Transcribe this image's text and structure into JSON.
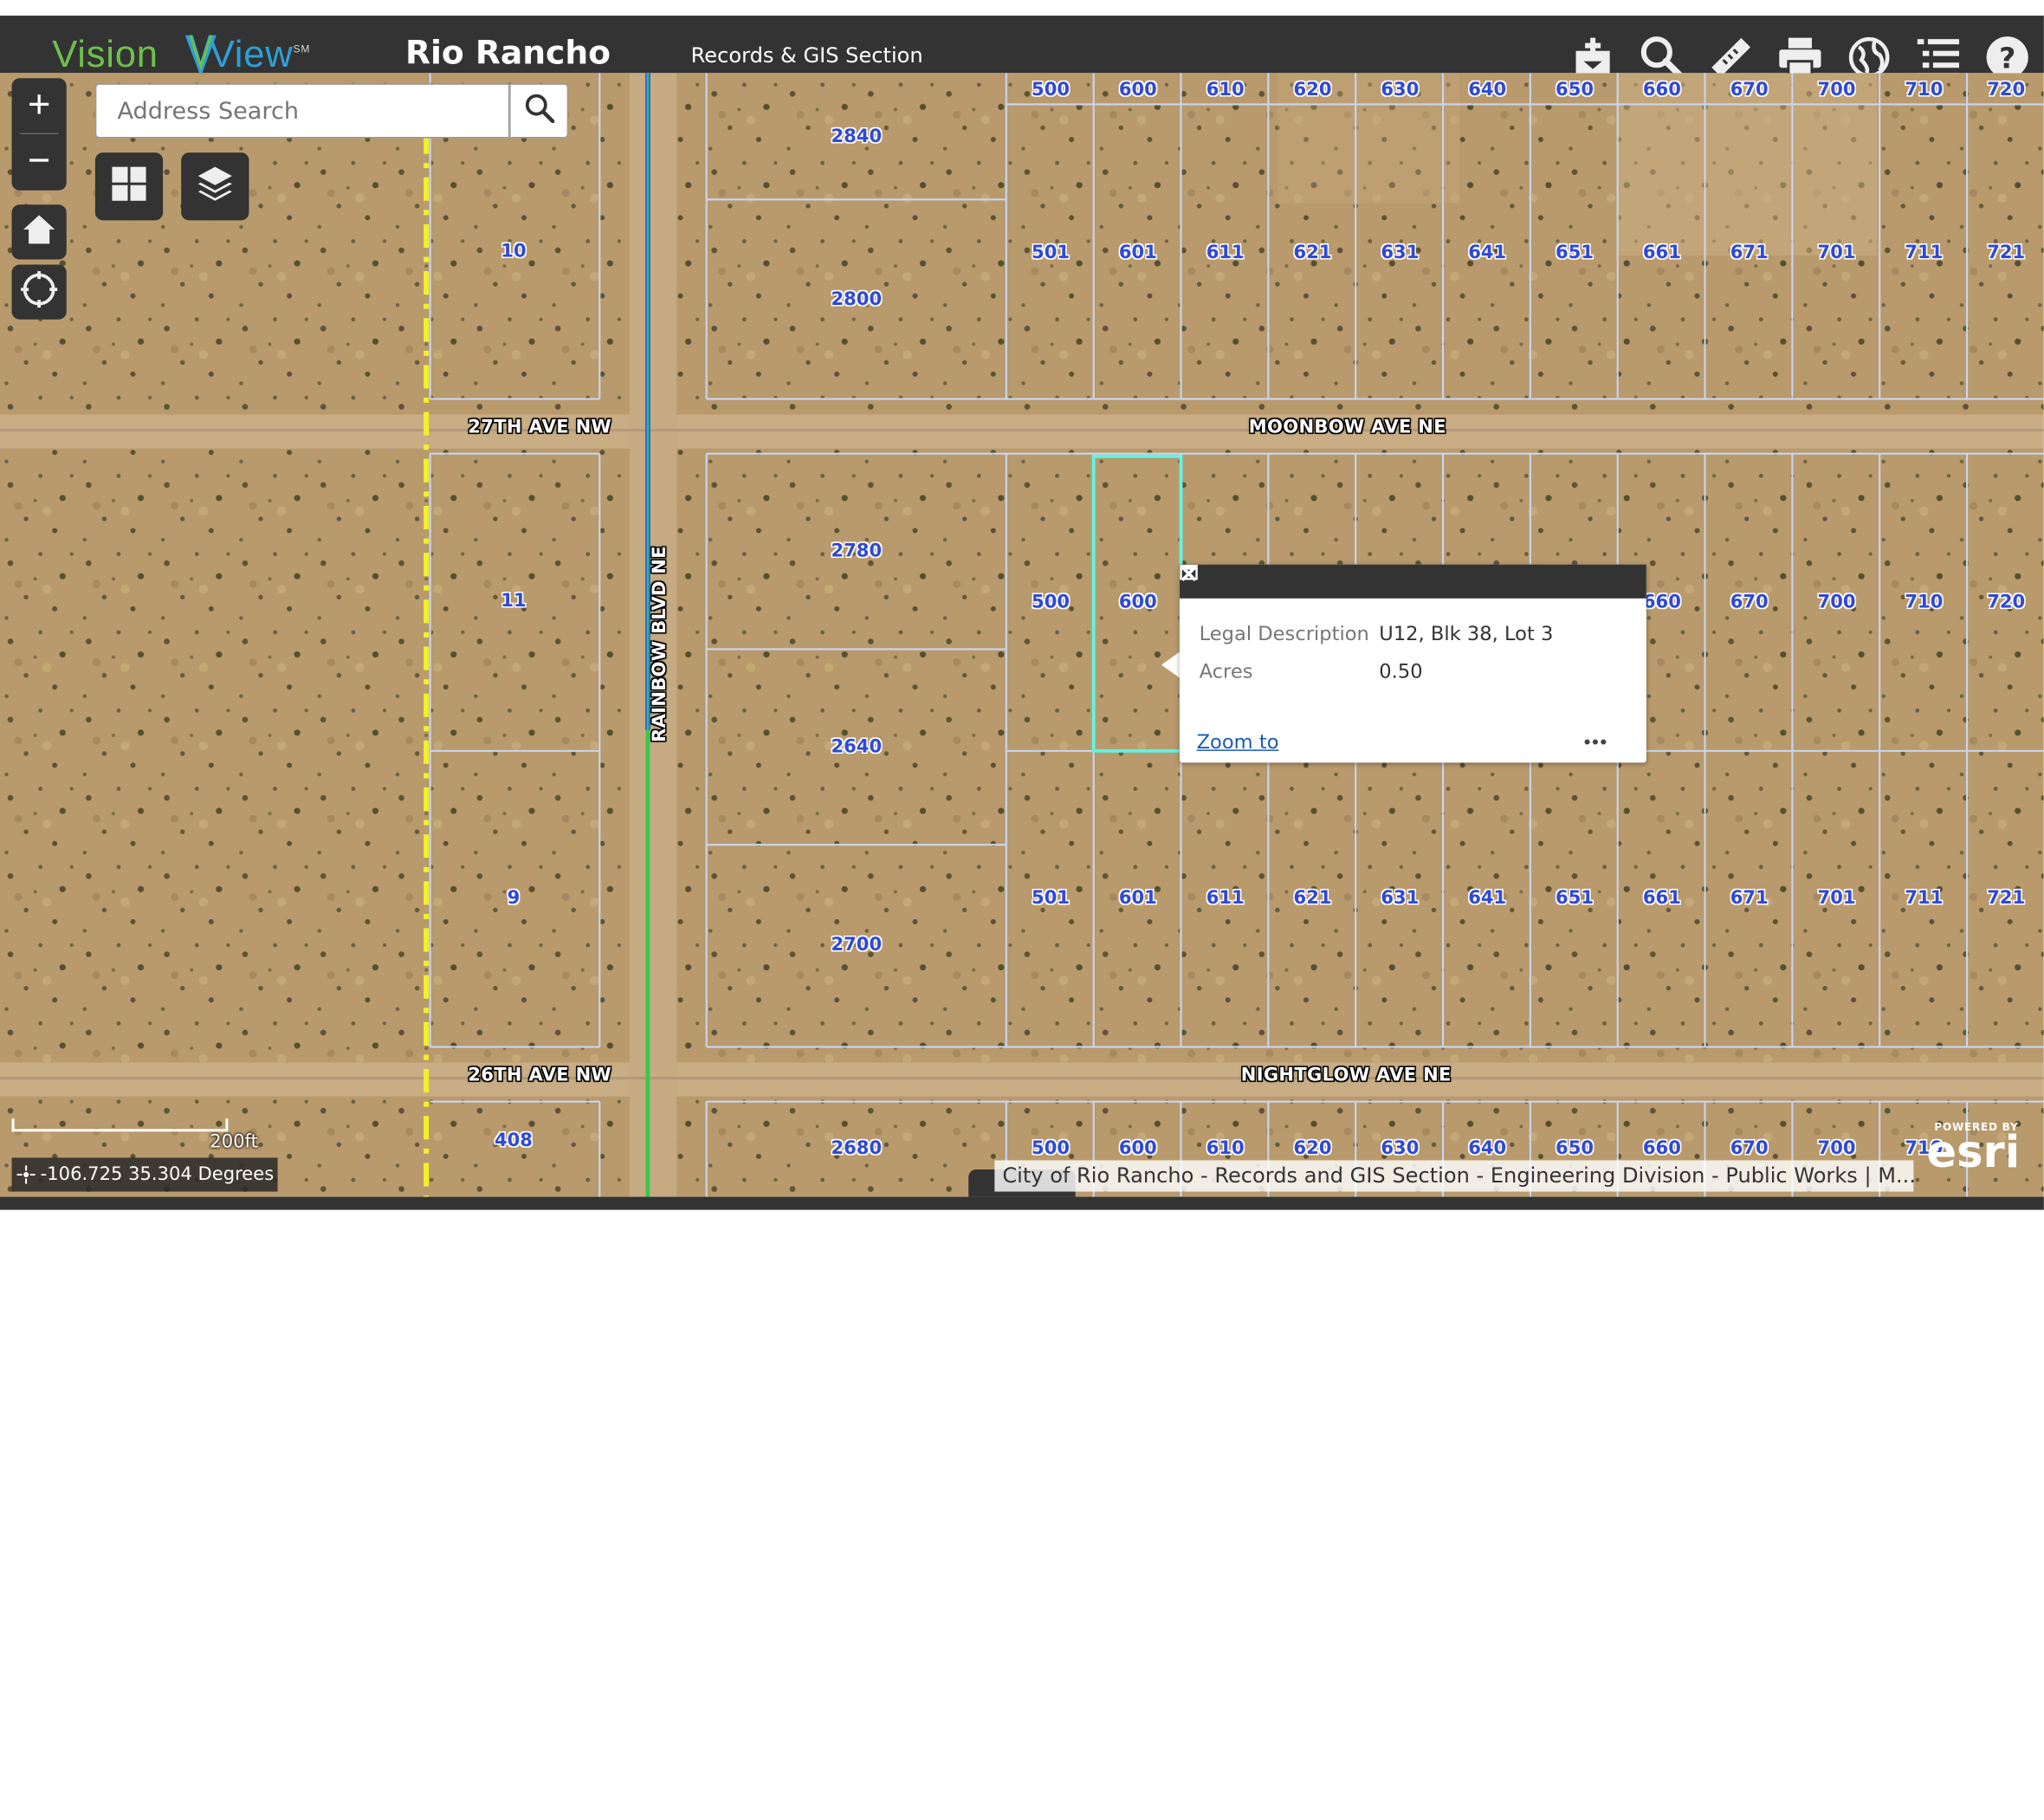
{
  "header": {
    "logo_part1": "Vision",
    "logo_part2": "View",
    "logo_sup": "SM",
    "app_title": "Rio Rancho",
    "subtitle": "Records & GIS Section",
    "tools": [
      "add-data-icon",
      "search-icon",
      "measure-icon",
      "print-icon",
      "basemap-icon",
      "layer-list-icon",
      "help-icon"
    ]
  },
  "controls": {
    "zoom_in": "+",
    "zoom_out": "−",
    "search_placeholder": "Address Search"
  },
  "map": {
    "streets": [
      "27TH AVE NW",
      "MOONBOW AVE NE",
      "RAINBOW BLVD NE",
      "26TH AVE NW",
      "NIGHTGLOW AVE NE"
    ],
    "lots_top_row": [
      "500",
      "600",
      "610",
      "620",
      "630",
      "640",
      "650",
      "660",
      "670",
      "700",
      "710",
      "720"
    ],
    "lots_second_row": [
      "501",
      "601",
      "611",
      "621",
      "631",
      "641",
      "651",
      "661",
      "671",
      "701",
      "711",
      "721"
    ],
    "lots_middle_row": [
      "500",
      "600",
      "660",
      "670",
      "700",
      "710",
      "720"
    ],
    "lots_lower_row": [
      "501",
      "601",
      "611",
      "621",
      "631",
      "641",
      "651",
      "661",
      "671",
      "701",
      "711",
      "721"
    ],
    "lots_bottom_row": [
      "500",
      "600",
      "610",
      "620",
      "630",
      "640",
      "650",
      "660",
      "670",
      "700",
      "710"
    ],
    "big_lots": [
      "2840",
      "2800",
      "2780",
      "2640",
      "2700",
      "2680"
    ],
    "west_lots": [
      "10",
      "11",
      "9",
      "408"
    ]
  },
  "popup": {
    "legal_label": "Legal Description",
    "legal_value": "U12, Blk 38, Lot 3",
    "acres_label": "Acres",
    "acres_value": "0.50",
    "zoom_to": "Zoom to",
    "more": "•••"
  },
  "footer": {
    "scale": "200ft",
    "coordinates": "-106.725 35.304 Degrees",
    "attribution": "City of Rio Rancho - Records and GIS Section - Engineering Division - Public Works | M...",
    "esri_powered": "POWERED BY",
    "esri_name": "esri"
  },
  "colors": {
    "header_bg": "#333333",
    "parcel_line": "#c9d6f2",
    "selected_parcel": "#5ff5e6",
    "lot_label": "#2f49d6",
    "rainbow_blue": "#2a6de0",
    "rainbow_green": "#34c94a",
    "yellow_line": "#f3f02a"
  }
}
